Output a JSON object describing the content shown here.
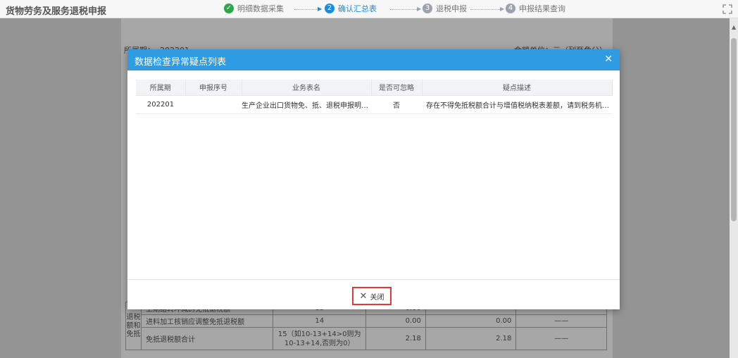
{
  "app": {
    "title": "货物劳务及服务退税申报"
  },
  "steps": [
    {
      "num": "✓",
      "label": "明细数据采集",
      "state": "done"
    },
    {
      "num": "2",
      "label": "确认汇总表",
      "state": "active"
    },
    {
      "num": "3",
      "label": "退税申报",
      "state": "todo"
    },
    {
      "num": "4",
      "label": "申报结果查询",
      "state": "todo"
    }
  ],
  "background": {
    "period_label": "所属期：",
    "period_value": "202201",
    "unit_label": "金额单位：元（列至角分）",
    "side_label": "退税额和免抵",
    "rows": [
      {
        "name": "上期结转冲减的免抵退税额",
        "code": "13",
        "v1": "0.00",
        "v2": "——",
        "v3": "——"
      },
      {
        "name": "进料加工核销应调整免抵退税额",
        "code": "14",
        "v1": "0.00",
        "v2": "0.00",
        "v3": "——"
      },
      {
        "name": "免抵退税额合计",
        "code": "15（如10-13+14>0则为10-13+14,否则为0）",
        "v1": "2.18",
        "v2": "2.18",
        "v3": "——"
      }
    ]
  },
  "modal": {
    "title": "数据检查异常疑点列表",
    "columns": [
      "所属期",
      "申报序号",
      "业务表名",
      "是否可忽略",
      "疑点描述"
    ],
    "rows": [
      {
        "period": "202201",
        "seq": "",
        "table": "生产企业出口货物免、抵、退税申报明细表",
        "ignorable": "否",
        "desc": "存在不得免抵税额合计与增值税纳税表差额，请到税务机关调整增值..."
      }
    ],
    "close_label": "关闭"
  }
}
